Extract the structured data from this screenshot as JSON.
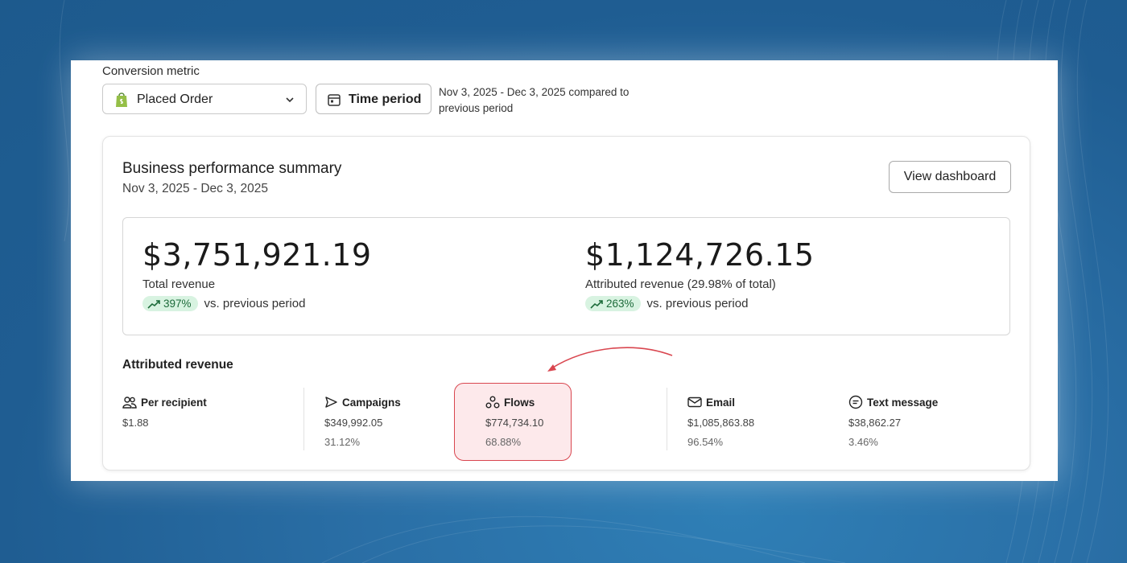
{
  "controls": {
    "conversion_metric_label": "Conversion metric",
    "conversion_metric_value": "Placed Order",
    "time_period_button": "Time period",
    "period_line1": "Nov 3, 2025 - Dec 3, 2025 compared to",
    "period_line2": "previous period"
  },
  "summary": {
    "title": "Business performance summary",
    "date_range": "Nov 3, 2025 - Dec 3, 2025",
    "view_dashboard_button": "View dashboard"
  },
  "kpis": [
    {
      "value": "$3,751,921.19",
      "label": "Total revenue",
      "change": "397%",
      "change_suffix": "vs. previous period"
    },
    {
      "value": "$1,124,726.15",
      "label": "Attributed revenue (29.98% of total)",
      "change": "263%",
      "change_suffix": "vs. previous period"
    }
  ],
  "attributed": {
    "title": "Attributed revenue",
    "metrics": [
      {
        "name": "Per recipient",
        "icon": "people-icon",
        "value": "$1.88",
        "pct": ""
      },
      {
        "name": "Campaigns",
        "icon": "send-icon",
        "value": "$349,992.05",
        "pct": "31.12%"
      },
      {
        "name": "Flows",
        "icon": "flows-icon",
        "value": "$774,734.10",
        "pct": "68.88%"
      },
      {
        "name": "Email",
        "icon": "email-icon",
        "value": "$1,085,863.88",
        "pct": "96.54%"
      },
      {
        "name": "Text message",
        "icon": "message-icon",
        "value": "$38,862.27",
        "pct": "3.46%"
      }
    ]
  },
  "colors": {
    "highlight_border": "#d9464f",
    "badge_bg": "#d8f3e1",
    "badge_text": "#1d6b3a",
    "background": "#2a6fa6"
  }
}
